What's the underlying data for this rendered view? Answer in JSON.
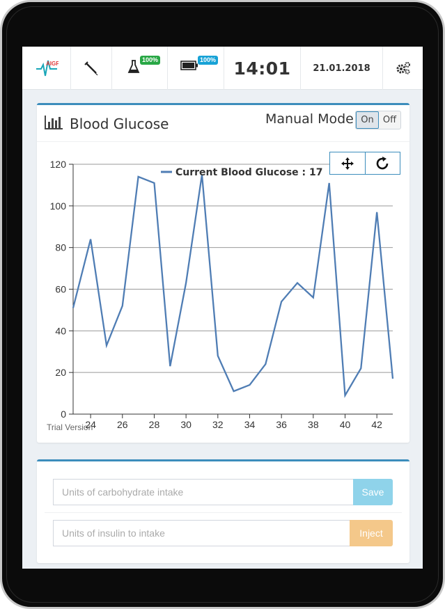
{
  "topbar": {
    "logo_text": "AIGP",
    "flask_badge": "100%",
    "battery_badge": "100%",
    "time": "14:01",
    "date": "21.01.2018",
    "colors": {
      "green_badge": "#28a745",
      "cyan_badge": "#17a2d6",
      "accent": "#3c8dbc"
    },
    "icons": [
      "logo-heartbeat-icon",
      "syringe-icon",
      "flask-icon",
      "battery-icon",
      "gears-icon"
    ]
  },
  "chart_panel": {
    "title": "Blood Glucose",
    "mode_label": "Manual Mode",
    "toggle_on": "On",
    "toggle_off": "Off",
    "toggle_state": "On",
    "trial_text": "Trial Version"
  },
  "chart_data": {
    "type": "line",
    "series": [
      {
        "name": "Current Blood Glucose",
        "x": [
          22.9,
          24,
          25,
          26,
          27,
          28,
          29,
          30,
          31,
          32,
          33,
          34,
          35,
          36,
          37,
          38,
          39,
          40,
          41,
          42,
          43
        ],
        "values": [
          51,
          84,
          33,
          52,
          114,
          111,
          23,
          63,
          115,
          28,
          11,
          14,
          24,
          54,
          63,
          56,
          111,
          9,
          22,
          97,
          17
        ]
      }
    ],
    "legend_text": "Current Blood Glucose : 17",
    "xticks": [
      24,
      26,
      28,
      30,
      32,
      34,
      36,
      38,
      40,
      42
    ],
    "yticks": [
      0,
      20,
      40,
      60,
      80,
      100,
      120
    ],
    "xlim": [
      22.9,
      43
    ],
    "ylim": [
      0,
      120
    ],
    "grid": "horizontal",
    "legend_position": "top-center",
    "line_color": "#4f7db4"
  },
  "input_panel": {
    "carb_placeholder": "Units of carbohydrate intake",
    "carb_value": "",
    "save_label": "Save",
    "insulin_placeholder": "Units of insulin to intake",
    "insulin_value": "",
    "inject_label": "Inject"
  }
}
